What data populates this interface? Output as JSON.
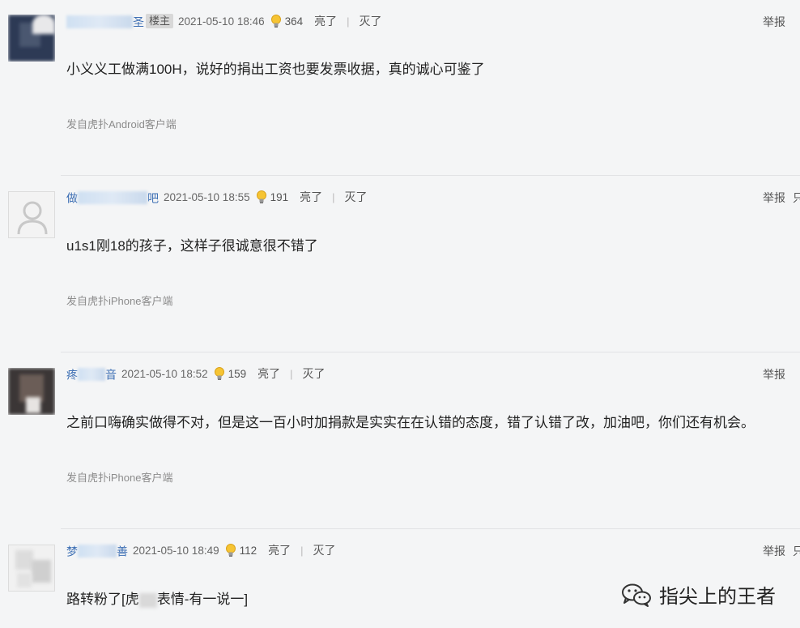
{
  "comments": [
    {
      "user_name_visible_suffix": "圣",
      "op_badge": "楼主",
      "time": "2021-05-10 18:46",
      "likes": "364",
      "light_label": "亮了",
      "dark_label": "灭了",
      "report_label": "举报",
      "content": "小义义工做满100H，说好的捐出工资也要发票收据，真的诚心可鉴了",
      "source": "发自虎扑Android客户端"
    },
    {
      "user_name_prefix": "做",
      "user_name_suffix": "吧",
      "time": "2021-05-10 18:55",
      "likes": "191",
      "light_label": "亮了",
      "dark_label": "灭了",
      "report_label": "举报",
      "report_cut": "只",
      "content": "u1s1刚18的孩子，这样子很诚意很不错了",
      "source": "发自虎扑iPhone客户端"
    },
    {
      "user_name_prefix": "疼",
      "user_name_suffix": "音",
      "time": "2021-05-10 18:52",
      "likes": "159",
      "light_label": "亮了",
      "dark_label": "灭了",
      "report_label": "举报",
      "content": "之前口嗨确实做得不对，但是这一百小时加捐款是实实在在认错的态度，错了认错了改，加油吧，你们还有机会。",
      "source": "发自虎扑iPhone客户端"
    },
    {
      "user_name_prefix": "梦",
      "user_name_suffix": "善",
      "time": "2021-05-10 18:49",
      "likes": "112",
      "light_label": "亮了",
      "dark_label": "灭了",
      "report_label": "举报",
      "report_cut": "只",
      "content_before": "路转粉了[虎",
      "content_after": "表情-有一说一]"
    }
  ],
  "watermark": {
    "text": "指尖上的王者",
    "icon": "wechat-icon"
  }
}
